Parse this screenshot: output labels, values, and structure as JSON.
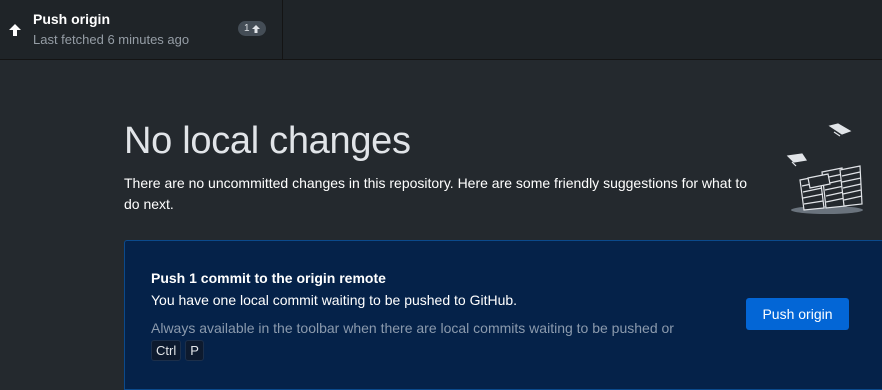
{
  "toolbar": {
    "push": {
      "title": "Push origin",
      "subtitle": "Last fetched 6 minutes ago",
      "ahead_count": "1",
      "icon": "arrow-up-icon"
    }
  },
  "blank_slate": {
    "heading": "No local changes",
    "intro": "There are no uncommitted changes in this repository. Here are some friendly suggestions for what to do next.",
    "illustration": "paper-stacks-illustration"
  },
  "suggestion": {
    "title": "Push 1 commit to the origin remote",
    "description": "You have one local commit waiting to be pushed to GitHub.",
    "hint": "Always available in the toolbar when there are local commits waiting to be pushed or",
    "shortcut_keys": [
      "Ctrl",
      "P"
    ],
    "button_label": "Push origin"
  },
  "colors": {
    "background": "#24292e",
    "toolbar": "#1f2428",
    "suggestion_bg": "#052249",
    "accent": "#0366d6"
  }
}
